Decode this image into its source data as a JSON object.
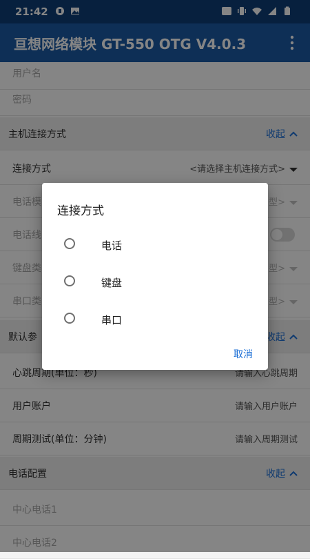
{
  "status": {
    "time": "21:42"
  },
  "app": {
    "title": "亘想网络模块 GT-550 OTG V4.0.3"
  },
  "form": {
    "top_fields": [
      "用户名",
      "密码"
    ],
    "host_section": {
      "title": "主机连接方式",
      "collapse": "收起",
      "connection_label": "连接方式",
      "connection_value": "<请选择主机连接方式>",
      "phone_model_label": "电话模",
      "phone_model_value": "型>",
      "phone_line_label": "电话线",
      "keyboard_label": "键盘类",
      "keyboard_value": "型>",
      "serial_label": "串口类",
      "serial_value": "型>"
    },
    "default_section": {
      "title": "默认参",
      "collapse": "收起",
      "rows": [
        {
          "label": "心跳周期(单位：秒)",
          "placeholder": "请输入心跳周期"
        },
        {
          "label": "用户账户",
          "placeholder": "请输入用户账户"
        },
        {
          "label": "周期测试(单位：分钟)",
          "placeholder": "请输入周期测试"
        }
      ]
    },
    "phone_section": {
      "title": "电话配置",
      "collapse": "收起",
      "rows": [
        "中心电话1",
        "中心电话2"
      ]
    }
  },
  "dialog": {
    "title": "连接方式",
    "options": [
      "电话",
      "键盘",
      "串口"
    ],
    "cancel": "取消"
  }
}
